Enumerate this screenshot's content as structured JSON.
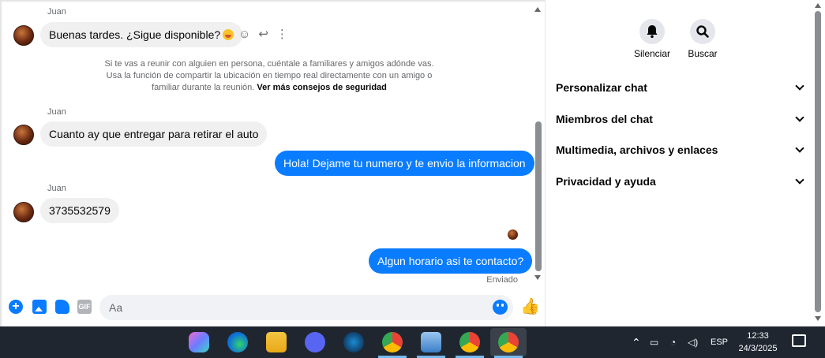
{
  "messages": {
    "m1": {
      "sender": "Juan",
      "text": "Buenas tardes. ¿Sigue disponible?"
    },
    "notice": {
      "text": "Si te vas a reunir con alguien en persona, cuéntale a familiares y amigos adónde vas. Usa la función de compartir la ubicación en tiempo real directamente con un amigo o familiar durante la reunión.",
      "link": "Ver más consejos de seguridad"
    },
    "m2": {
      "sender": "Juan",
      "text": "Cuanto ay que entregar para retirar el auto"
    },
    "m3": {
      "text": "Hola! Dejame tu numero y te envio la informacion"
    },
    "m4": {
      "sender": "Juan",
      "text": "3735532579"
    },
    "m5": {
      "text": "Algun horario asi te contacto?"
    },
    "status": "Enviado"
  },
  "composer": {
    "placeholder": "Aa",
    "gif_label": "GIF"
  },
  "right_panel": {
    "actions": [
      {
        "label": "Silenciar",
        "icon": "bell-icon"
      },
      {
        "label": "Buscar",
        "icon": "search-icon"
      }
    ],
    "sections": [
      "Personalizar chat",
      "Miembros del chat",
      "Multimedia, archivos y enlaces",
      "Privacidad y ayuda"
    ]
  },
  "taskbar": {
    "language": "ESP",
    "time": "12:33",
    "date": "24/3/2025",
    "apps": [
      "copilot-icon",
      "edge-icon",
      "file-explorer-icon",
      "discord-icon",
      "steam-icon",
      "chrome-icon",
      "network-app-icon",
      "chrome-profile-icon",
      "chrome-c-icon"
    ]
  },
  "colors": {
    "outgoing_bubble": "#0a7cff",
    "incoming_bubble": "#f0f0f0",
    "taskbar": "#1f2630"
  }
}
